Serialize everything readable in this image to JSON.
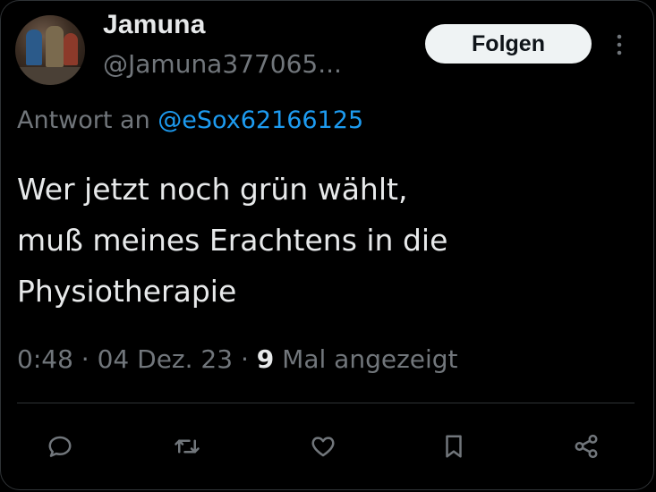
{
  "author": {
    "name": "Jamuna",
    "handle": "@Jamuna377065..."
  },
  "follow_button": {
    "label": "Folgen"
  },
  "reply_to": {
    "prefix": "Antwort an",
    "mention": "@eSox62166125"
  },
  "tweet": {
    "lines": [
      "Wer jetzt noch grün wählt,",
      "muß meines Erachtens in die",
      "Physiotherapie"
    ]
  },
  "meta": {
    "time": "0:48",
    "separator": "·",
    "date": "04 Dez. 23",
    "views_count": "9",
    "views_label": "Mal angezeigt"
  },
  "actions": [
    {
      "name": "reply-icon"
    },
    {
      "name": "retweet-icon"
    },
    {
      "name": "like-icon"
    },
    {
      "name": "bookmark-icon"
    },
    {
      "name": "share-icon"
    }
  ],
  "colors": {
    "background": "#000000",
    "text": "#e7e9ea",
    "muted": "#71767b",
    "link": "#1d9bf0",
    "follow_bg": "#eff3f4"
  }
}
